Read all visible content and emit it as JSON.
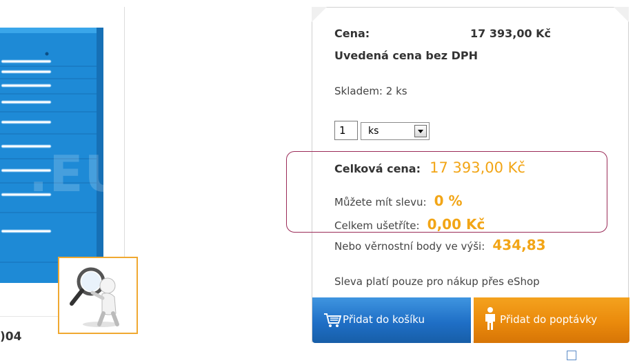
{
  "gallery": {
    "watermark_text": ".EU",
    "sku_fragment": ")04"
  },
  "product": {
    "price_label": "Cena:",
    "price_value": "17 393,00 Kč",
    "vat_note": "Uvedená cena bez DPH",
    "stock_text": "Skladem: 2 ks",
    "quantity_value": "1",
    "unit_selected": "ks",
    "total_label": "Celková cena:",
    "total_value": "17 393,00 Kč",
    "discount_label": "Můžete mít slevu:",
    "discount_value": "0 %",
    "saved_label": "Celkem ušetříte:",
    "saved_value": "0,00 Kč",
    "points_label": "Nebo věrnostní body ve výši:",
    "points_value": "434,83",
    "eshop_note": "Sleva platí pouze pro nákup přes eShop"
  },
  "buttons": {
    "add_to_cart": "Přidat do košíku",
    "add_to_inquiry": "Přidat do poptávky"
  },
  "icons": {
    "cart": "cart-icon",
    "person": "person-icon",
    "zoom": "magnifier-figure-icon"
  },
  "colors": {
    "accent_orange": "#f2a516",
    "cart_blue": "#1f6fc6",
    "inquiry_orange": "#ea8a0c",
    "highlight_border": "#9a2a57",
    "zoom_border": "#f0a830"
  }
}
